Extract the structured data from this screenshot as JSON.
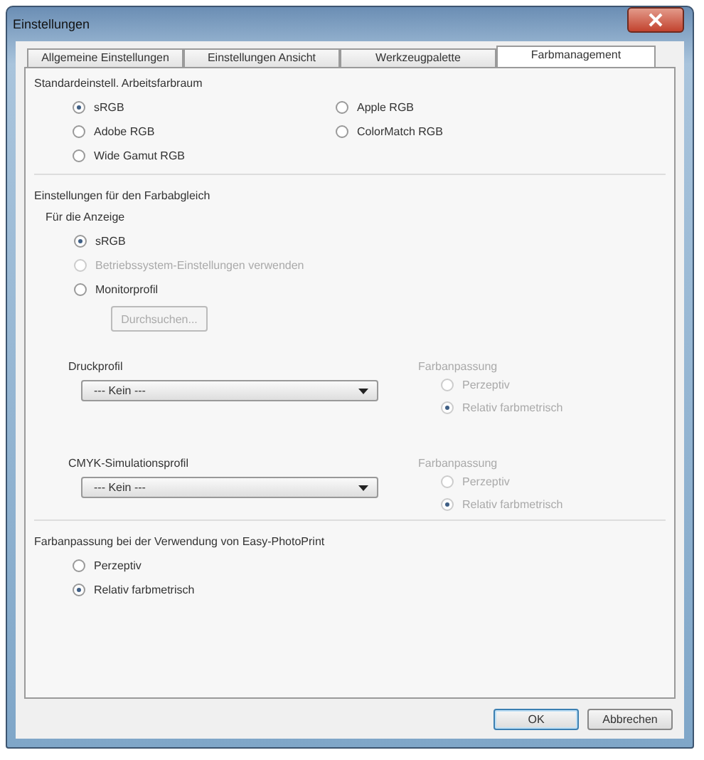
{
  "window": {
    "title": "Einstellungen"
  },
  "tabs": [
    {
      "label": "Allgemeine Einstellungen",
      "selected": false
    },
    {
      "label": "Einstellungen Ansicht",
      "selected": false
    },
    {
      "label": "Werkzeugpalette",
      "selected": false
    },
    {
      "label": "Farbmanagement",
      "selected": true
    }
  ],
  "working_space": {
    "title": "Standardeinstell. Arbeitsfarbraum",
    "options": [
      {
        "label": "sRGB",
        "selected": true
      },
      {
        "label": "Apple RGB",
        "selected": false
      },
      {
        "label": "Adobe RGB",
        "selected": false
      },
      {
        "label": "ColorMatch RGB",
        "selected": false
      },
      {
        "label": "Wide Gamut RGB",
        "selected": false
      }
    ]
  },
  "color_matching": {
    "title": "Einstellungen für den Farbabgleich",
    "display": {
      "label": "Für die Anzeige",
      "options": [
        {
          "label": "sRGB",
          "selected": true,
          "disabled": false
        },
        {
          "label": "Betriebssystem-Einstellungen verwenden",
          "selected": false,
          "disabled": true
        },
        {
          "label": "Monitorprofil",
          "selected": false,
          "disabled": false
        }
      ],
      "browse_button": {
        "label": "Durchsuchen...",
        "disabled": true
      }
    },
    "profiles": [
      {
        "label": "Druckprofil",
        "value": "--- Kein ---",
        "intent": {
          "label": "Farbanpassung",
          "disabled": true,
          "options": [
            {
              "label": "Perzeptiv",
              "selected": false
            },
            {
              "label": "Relativ farbmetrisch",
              "selected": true
            }
          ]
        }
      },
      {
        "label": "CMYK-Simulationsprofil",
        "value": "--- Kein ---",
        "intent": {
          "label": "Farbanpassung",
          "disabled": true,
          "options": [
            {
              "label": "Perzeptiv",
              "selected": false
            },
            {
              "label": "Relativ farbmetrisch",
              "selected": true
            }
          ]
        }
      }
    ]
  },
  "print_matching": {
    "title": "Farbanpassung bei der Verwendung von Easy-PhotoPrint",
    "options": [
      {
        "label": "Perzeptiv",
        "selected": false
      },
      {
        "label": "Relativ farbmetrisch",
        "selected": true
      }
    ]
  },
  "buttons": [
    {
      "label": "OK",
      "default": true
    },
    {
      "label": "Abbrechen",
      "default": false
    }
  ]
}
